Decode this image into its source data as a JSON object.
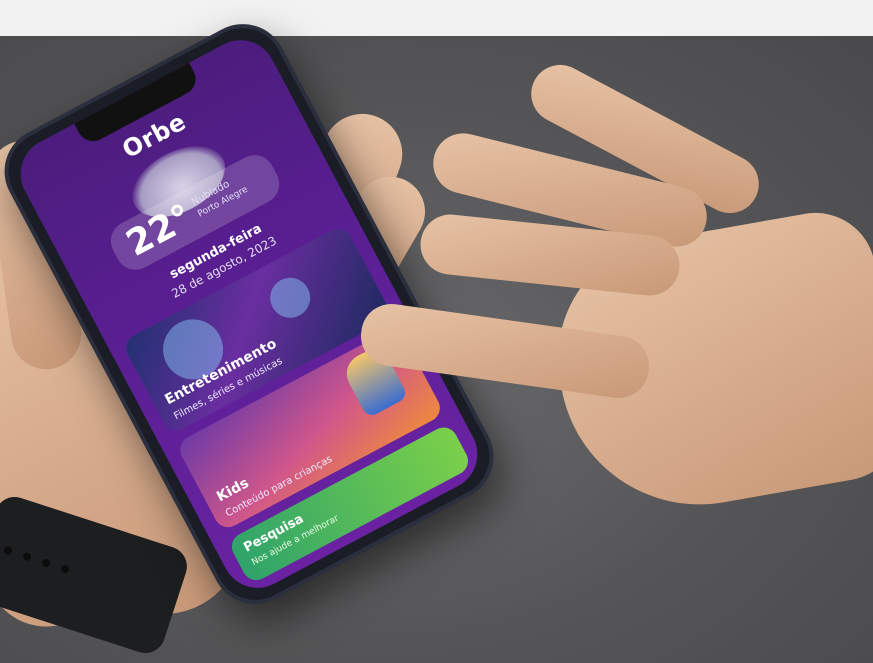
{
  "app": {
    "name": "Orbe"
  },
  "weather": {
    "temperature": "22°",
    "condition": "Nublado",
    "city": "Porto Alegre",
    "weekday": "segunda-feira",
    "date": "28 de agosto, 2023"
  },
  "cards": [
    {
      "title": "Entretenimento",
      "subtitle": "Filmes, séries e músicas"
    },
    {
      "title": "Kids",
      "subtitle": "Conteúdo para crianças"
    },
    {
      "title": "Pesquisa",
      "subtitle": "Nos ajude a melhorar"
    }
  ]
}
